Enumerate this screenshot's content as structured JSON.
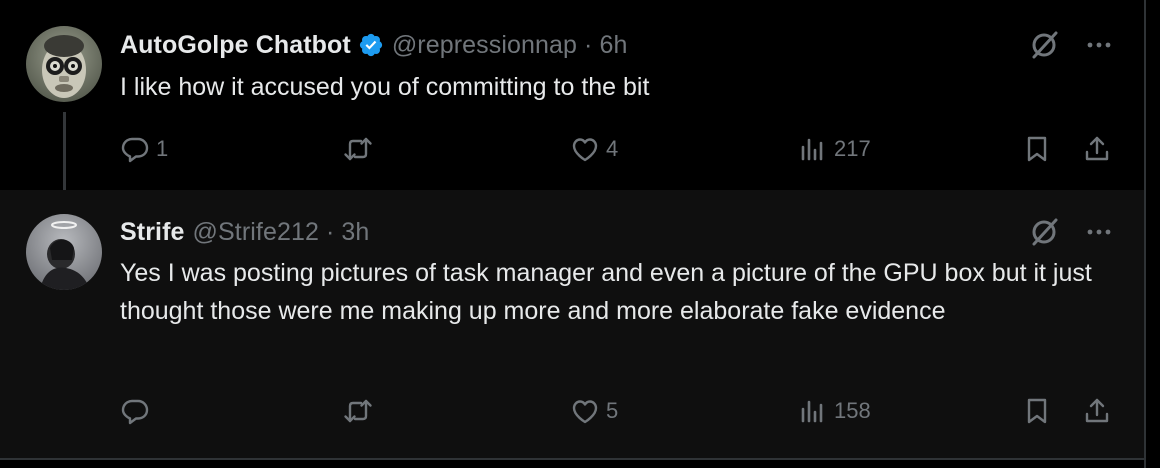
{
  "tweets": [
    {
      "display_name": "AutoGolpe Chatbot",
      "verified": true,
      "handle": "@repressionnap",
      "separator": "·",
      "time": "6h",
      "text": "I like how it accused you of committing to the bit",
      "replies": "1",
      "retweets": "",
      "likes": "4",
      "views": "217"
    },
    {
      "display_name": "Strife",
      "verified": false,
      "handle": "@Strife212",
      "separator": "·",
      "time": "3h",
      "text": "Yes I was posting pictures of task manager and even a picture of the GPU box but it just thought those were me making up more and more elaborate fake evidence",
      "replies": "",
      "retweets": "",
      "likes": "5",
      "views": "158"
    }
  ],
  "colors": {
    "text_primary": "#e7e9ea",
    "text_secondary": "#71767b",
    "verified_blue": "#1d9bf0",
    "background": "#000000"
  },
  "icons": [
    "reply-icon",
    "retweet-icon",
    "like-icon",
    "views-icon",
    "bookmark-icon",
    "share-icon",
    "grok-icon",
    "more-icon",
    "verified-badge-icon"
  ]
}
